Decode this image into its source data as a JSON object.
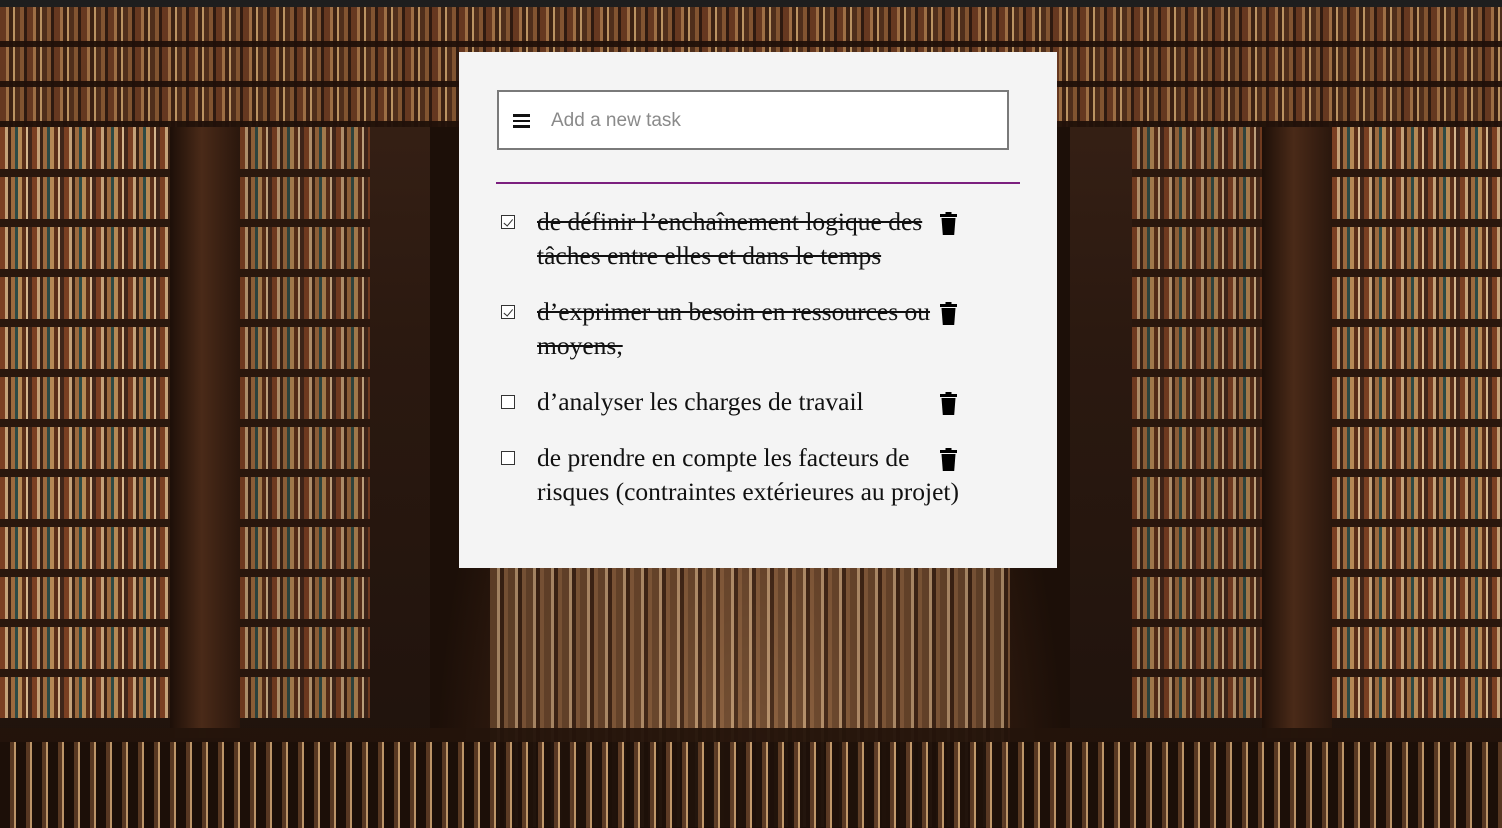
{
  "input": {
    "placeholder": "Add a new task",
    "value": "",
    "menu_icon": "hamburger-menu-icon"
  },
  "theme": {
    "divider_color": "#7b1f7e",
    "card_background": "#f4f4f4"
  },
  "tasks": [
    {
      "text": "de définir l’enchaînement logique des tâches entre elles et dans le temps",
      "done": true,
      "delete_icon": "trash-icon"
    },
    {
      "text": "d’exprimer un besoin en ressources ou moyens,",
      "done": true,
      "delete_icon": "trash-icon"
    },
    {
      "text": "d’analyser les charges de travail",
      "done": false,
      "delete_icon": "trash-icon"
    },
    {
      "text": "de prendre en compte les facteurs de risques (contraintes extérieures au projet)",
      "done": false,
      "delete_icon": "trash-icon"
    }
  ]
}
